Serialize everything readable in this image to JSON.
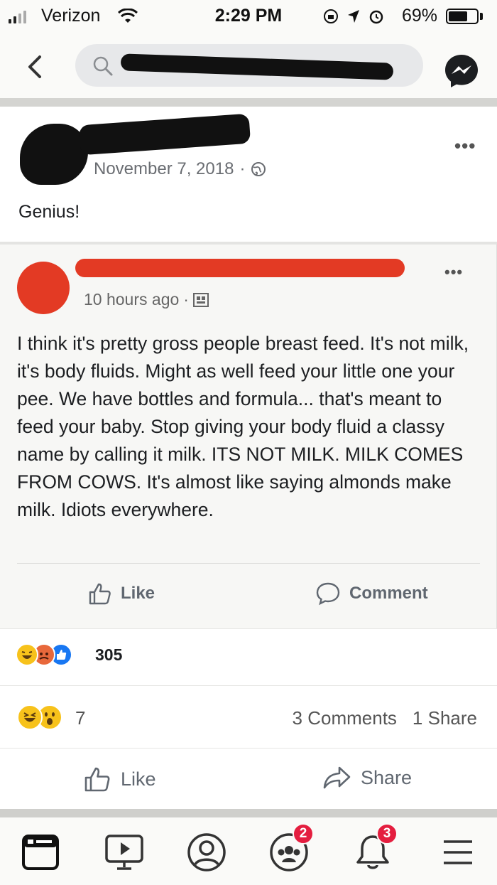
{
  "status_bar": {
    "carrier": "Verizon",
    "time": "2:29 PM",
    "battery_percent": "69%",
    "battery_level": 0.69
  },
  "nav": {
    "icons": [
      "back-icon",
      "search-icon",
      "messenger-icon"
    ]
  },
  "post": {
    "date": "November 7, 2018",
    "separator": "·",
    "privacy_icon": "globe-icon",
    "caption": "Genius!",
    "more_icon": "more-icon"
  },
  "shared_screenshot": {
    "time_ago": "10 hours ago",
    "separator": "·",
    "privacy_icon": "friends-icon",
    "body": "I think it's pretty gross people breast feed. It's not milk, it's body fluids. Might as well feed your little one your pee. We have bottles and formula... that's meant to feed your baby. Stop giving your body fluid a classy name by calling it milk. ITS NOT MILK. MILK COMES FROM COWS. It's almost like saying almonds make milk. Idiots everywhere.",
    "actions": {
      "like_label": "Like",
      "comment_label": "Comment"
    },
    "reactions": [
      "haha-emoji",
      "angry-emoji",
      "like-emoji"
    ],
    "reactions_count": "305"
  },
  "post_stats": {
    "reactions": [
      "laugh-emoji",
      "wow-emoji"
    ],
    "reactions_count": "7",
    "comments": "3 Comments",
    "shares": "1 Share"
  },
  "post_actions": {
    "like_label": "Like",
    "share_label": "Share"
  },
  "tab_bar": {
    "tabs": [
      {
        "name": "news-feed",
        "icon": "news-feed-icon"
      },
      {
        "name": "watch",
        "icon": "watch-icon"
      },
      {
        "name": "profile",
        "icon": "profile-icon"
      },
      {
        "name": "groups",
        "icon": "groups-icon",
        "badge": "2"
      },
      {
        "name": "notifications",
        "icon": "bell-icon",
        "badge": "3"
      },
      {
        "name": "menu",
        "icon": "menu-icon"
      }
    ]
  },
  "colors": {
    "facebook_blue": "#1877f2",
    "badge_red": "#e41e3f",
    "redaction_red": "#e33a24",
    "redaction_black": "#111111"
  }
}
